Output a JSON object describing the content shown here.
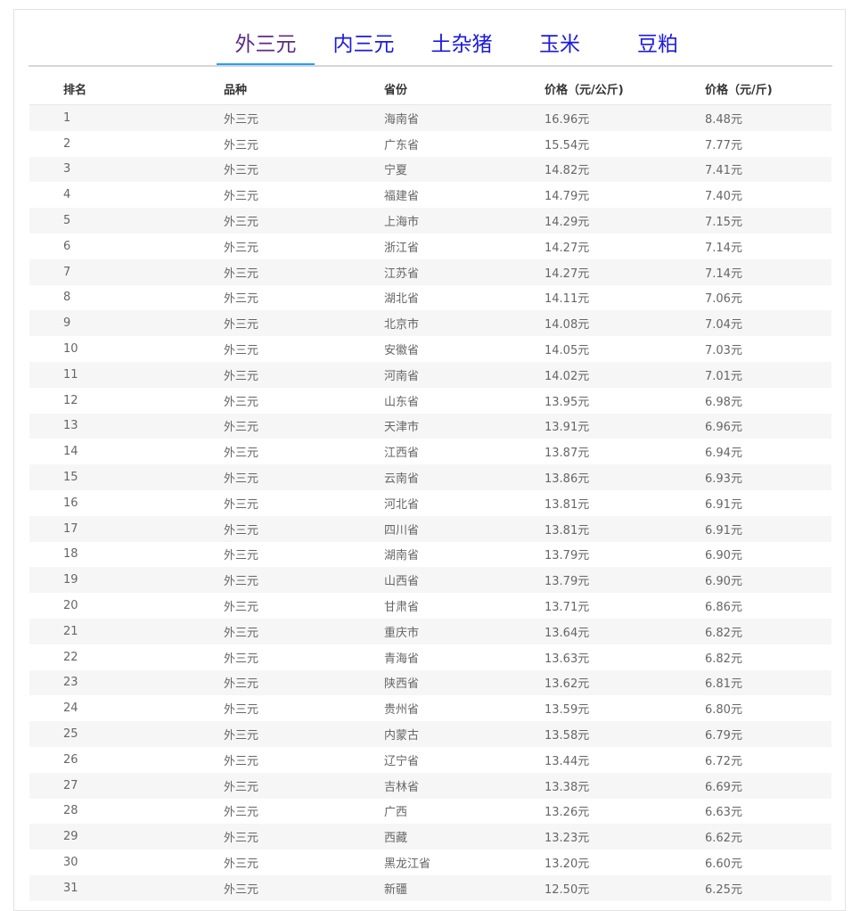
{
  "tabs": [
    {
      "label": "外三元",
      "active": true
    },
    {
      "label": "内三元",
      "active": false
    },
    {
      "label": "土杂猪",
      "active": false
    },
    {
      "label": "玉米",
      "active": false
    },
    {
      "label": "豆粕",
      "active": false
    }
  ],
  "colors": {
    "tab_link": "#1a1adf",
    "tab_active": "#5b2a86",
    "tab_indicator": "#1e9fff",
    "row_stripe": "#f6f6f6"
  },
  "table": {
    "headers": [
      "排名",
      "品种",
      "省份",
      "价格（元/公斤)",
      "价格（元/斤)"
    ],
    "rows": [
      [
        "1",
        "外三元",
        "海南省",
        "16.96元",
        "8.48元"
      ],
      [
        "2",
        "外三元",
        "广东省",
        "15.54元",
        "7.77元"
      ],
      [
        "3",
        "外三元",
        "宁夏",
        "14.82元",
        "7.41元"
      ],
      [
        "4",
        "外三元",
        "福建省",
        "14.79元",
        "7.40元"
      ],
      [
        "5",
        "外三元",
        "上海市",
        "14.29元",
        "7.15元"
      ],
      [
        "6",
        "外三元",
        "浙江省",
        "14.27元",
        "7.14元"
      ],
      [
        "7",
        "外三元",
        "江苏省",
        "14.27元",
        "7.14元"
      ],
      [
        "8",
        "外三元",
        "湖北省",
        "14.11元",
        "7.06元"
      ],
      [
        "9",
        "外三元",
        "北京市",
        "14.08元",
        "7.04元"
      ],
      [
        "10",
        "外三元",
        "安徽省",
        "14.05元",
        "7.03元"
      ],
      [
        "11",
        "外三元",
        "河南省",
        "14.02元",
        "7.01元"
      ],
      [
        "12",
        "外三元",
        "山东省",
        "13.95元",
        "6.98元"
      ],
      [
        "13",
        "外三元",
        "天津市",
        "13.91元",
        "6.96元"
      ],
      [
        "14",
        "外三元",
        "江西省",
        "13.87元",
        "6.94元"
      ],
      [
        "15",
        "外三元",
        "云南省",
        "13.86元",
        "6.93元"
      ],
      [
        "16",
        "外三元",
        "河北省",
        "13.81元",
        "6.91元"
      ],
      [
        "17",
        "外三元",
        "四川省",
        "13.81元",
        "6.91元"
      ],
      [
        "18",
        "外三元",
        "湖南省",
        "13.79元",
        "6.90元"
      ],
      [
        "19",
        "外三元",
        "山西省",
        "13.79元",
        "6.90元"
      ],
      [
        "20",
        "外三元",
        "甘肃省",
        "13.71元",
        "6.86元"
      ],
      [
        "21",
        "外三元",
        "重庆市",
        "13.64元",
        "6.82元"
      ],
      [
        "22",
        "外三元",
        "青海省",
        "13.63元",
        "6.82元"
      ],
      [
        "23",
        "外三元",
        "陕西省",
        "13.62元",
        "6.81元"
      ],
      [
        "24",
        "外三元",
        "贵州省",
        "13.59元",
        "6.80元"
      ],
      [
        "25",
        "外三元",
        "内蒙古",
        "13.58元",
        "6.79元"
      ],
      [
        "26",
        "外三元",
        "辽宁省",
        "13.44元",
        "6.72元"
      ],
      [
        "27",
        "外三元",
        "吉林省",
        "13.38元",
        "6.69元"
      ],
      [
        "28",
        "外三元",
        "广西",
        "13.26元",
        "6.63元"
      ],
      [
        "29",
        "外三元",
        "西藏",
        "13.23元",
        "6.62元"
      ],
      [
        "30",
        "外三元",
        "黑龙江省",
        "13.20元",
        "6.60元"
      ],
      [
        "31",
        "外三元",
        "新疆",
        "12.50元",
        "6.25元"
      ]
    ]
  }
}
